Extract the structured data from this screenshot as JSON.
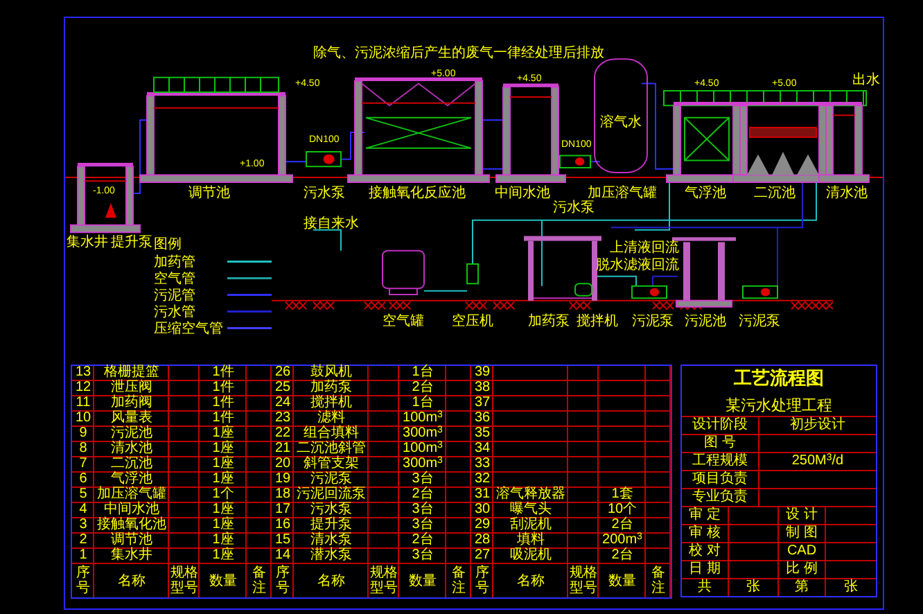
{
  "units": [
    {
      "label": "集水井",
      "kind": "pit"
    },
    {
      "label": "提升泵",
      "kind": "submersible_pump"
    },
    {
      "label": "调节池",
      "kind": "tank_railing"
    },
    {
      "label": "污水泵",
      "kind": "pump"
    },
    {
      "label": "接触氧化反应池",
      "kind": "reactor"
    },
    {
      "label": "中间水池",
      "kind": "small_tank"
    },
    {
      "label": "污水泵",
      "kind": "pump"
    },
    {
      "label": "加压溶气罐",
      "kind": "vessel"
    },
    {
      "label": "气浮池",
      "kind": "flotation"
    },
    {
      "label": "二沉池",
      "kind": "clarifier"
    },
    {
      "label": "清水池",
      "kind": "clear_tank"
    },
    {
      "label": "空气罐",
      "kind": "air_tank"
    },
    {
      "label": "空压机",
      "kind": "flowmeter"
    },
    {
      "label": "加药泵",
      "kind": "dosing"
    },
    {
      "label": "搅拌机",
      "kind": "mixer"
    },
    {
      "label": "污泥泵",
      "kind": "pump"
    },
    {
      "label": "污泥池",
      "kind": "sludge_tank"
    },
    {
      "label": "污泥泵",
      "kind": "pump"
    }
  ],
  "annotations": [
    {
      "text": "除气、污泥浓缩后产生的废气一律经处理后排放",
      "kind": "note"
    },
    {
      "text": "+4.50",
      "kind": "elevation"
    },
    {
      "text": "+1.00",
      "kind": "elevation"
    },
    {
      "text": "-1.00",
      "kind": "elevation"
    },
    {
      "text": "+5.00",
      "kind": "elevation"
    },
    {
      "text": "+4.50",
      "kind": "elevation"
    },
    {
      "text": "+4.50",
      "kind": "elevation"
    },
    {
      "text": "+5.00",
      "kind": "elevation"
    },
    {
      "text": "DN100",
      "kind": "pipe_size"
    },
    {
      "text": "DN100",
      "kind": "pipe_size"
    },
    {
      "text": "接自来水",
      "kind": "label"
    },
    {
      "text": "上清液回流",
      "kind": "label"
    },
    {
      "text": "脱水滤液回流",
      "kind": "label"
    },
    {
      "text": "出水",
      "kind": "label"
    },
    {
      "text": "溶气水",
      "kind": "label"
    }
  ],
  "legend": {
    "title": "图例",
    "items": [
      {
        "label": "加药管",
        "color": "#20c0c0"
      },
      {
        "label": "空气管",
        "color": "#20a0a0"
      },
      {
        "label": "污泥管",
        "color": "#3030ff"
      },
      {
        "label": "污水管",
        "color": "#2020d0"
      },
      {
        "label": "压缩空气管",
        "color": "#4040ff"
      }
    ]
  },
  "equipment_table": {
    "groups": [
      {
        "columns": [
          "序号",
          "名称",
          "规格型号",
          "数量",
          "备注"
        ],
        "rows": [
          {
            "no": "13",
            "name": "格栅提篮",
            "qty": "1件"
          },
          {
            "no": "12",
            "name": "泄压阀",
            "qty": "1件"
          },
          {
            "no": "11",
            "name": "加药阀",
            "qty": "1件"
          },
          {
            "no": "10",
            "name": "风量表",
            "qty": "1件"
          },
          {
            "no": "9",
            "name": "污泥池",
            "qty": "1座"
          },
          {
            "no": "8",
            "name": "清水池",
            "qty": "1座"
          },
          {
            "no": "7",
            "name": "二沉池",
            "qty": "1座"
          },
          {
            "no": "6",
            "name": "气浮池",
            "qty": "1座"
          },
          {
            "no": "5",
            "name": "加压溶气罐",
            "qty": "1个"
          },
          {
            "no": "4",
            "name": "中间水池",
            "qty": "1座"
          },
          {
            "no": "3",
            "name": "接触氧化池",
            "qty": "1座"
          },
          {
            "no": "2",
            "name": "调节池",
            "qty": "1座"
          },
          {
            "no": "1",
            "name": "集水井",
            "qty": "1座"
          }
        ]
      },
      {
        "columns": [
          "序号",
          "名称",
          "规格型号",
          "数量",
          "备注"
        ],
        "rows": [
          {
            "no": "26",
            "name": "鼓风机",
            "qty": "1台"
          },
          {
            "no": "25",
            "name": "加药泵",
            "qty": "2台"
          },
          {
            "no": "24",
            "name": "搅拌机",
            "qty": "1台"
          },
          {
            "no": "23",
            "name": "滤料",
            "qty": "100m$^{3}$"
          },
          {
            "no": "22",
            "name": "组合填料",
            "qty": "300m$^{3}$"
          },
          {
            "no": "21",
            "name": "二沉池斜管",
            "qty": "100m$^{3}$"
          },
          {
            "no": "20",
            "name": "斜管支架",
            "qty": "300m$^{3}$"
          },
          {
            "no": "19",
            "name": "污泥泵",
            "qty": "3台"
          },
          {
            "no": "18",
            "name": "污泥回流泵",
            "qty": "2台"
          },
          {
            "no": "17",
            "name": "污水泵",
            "qty": "3台"
          },
          {
            "no": "16",
            "name": "提升泵",
            "qty": "3台"
          },
          {
            "no": "15",
            "name": "清水泵",
            "qty": "2台"
          },
          {
            "no": "14",
            "name": "潜水泵",
            "qty": "3台"
          }
        ]
      },
      {
        "columns": [
          "序号",
          "名称",
          "规格型号",
          "数量",
          "备注"
        ],
        "rows": [
          {
            "no": "39"
          },
          {
            "no": "38"
          },
          {
            "no": "37"
          },
          {
            "no": "36"
          },
          {
            "no": "35"
          },
          {
            "no": "34"
          },
          {
            "no": "33"
          },
          {
            "no": "32"
          },
          {
            "no": "31",
            "name": "溶气释放器",
            "qty": "1套"
          },
          {
            "no": "30",
            "name": "曝气头",
            "qty": "10个"
          },
          {
            "no": "29",
            "name": "刮泥机",
            "qty": "2台"
          },
          {
            "no": "28",
            "name": "填料",
            "qty": "200m$^{3}$"
          },
          {
            "no": "27",
            "name": "吸泥机",
            "qty": "2台"
          }
        ]
      }
    ]
  },
  "title_block": {
    "title": "工艺流程图",
    "project": "某污水处理工程",
    "info": [
      {
        "label": "设计阶段",
        "value": "初步设计"
      },
      {
        "label": "图 号"
      },
      {
        "label": "工程规模",
        "value": "250M$^{3}$/d"
      }
    ],
    "responsibles": [
      "项目负责",
      "专业负责"
    ],
    "signatures": [
      {
        "left": "审 定",
        "right": "设 计"
      },
      {
        "left": "审 核",
        "right": "制 图"
      },
      {
        "left": "校 对",
        "right": "CAD"
      },
      {
        "left": "日 期",
        "right": "比 例"
      }
    ],
    "sheet": [
      "共",
      "张",
      "第",
      "张"
    ]
  }
}
